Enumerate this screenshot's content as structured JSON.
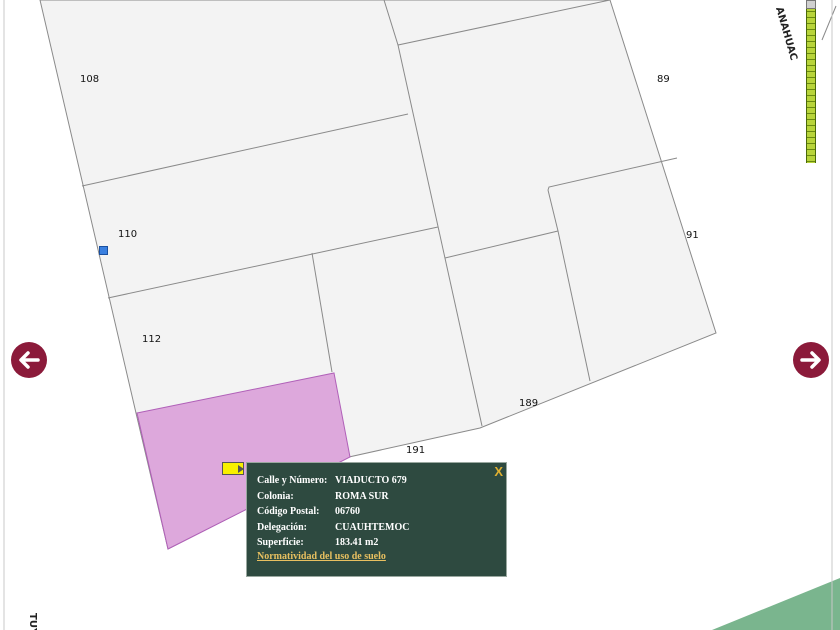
{
  "map": {
    "lot_labels": [
      "108",
      "89",
      "110",
      "91",
      "112",
      "189",
      "191"
    ],
    "street_labels": {
      "anahuac": "ANAHUAC",
      "tuxpan": "TUY"
    },
    "colors": {
      "lot_fill": "#f3f3f3",
      "lot_border": "#8a8a8a",
      "selected_fill": "#dda8dc",
      "selected_border": "#b060b8",
      "park_fill": "#7ab58e"
    }
  },
  "nav": {
    "left_icon": "arrow-left-icon",
    "right_icon": "arrow-right-icon",
    "color": "#8b1a3a"
  },
  "popup": {
    "close_label": "X",
    "rows": [
      {
        "key": "Calle y Número:",
        "value": "VIADUCTO 679"
      },
      {
        "key": "Colonia:",
        "value": "ROMA SUR"
      },
      {
        "key": "Código Postal:",
        "value": "06760"
      },
      {
        "key": "Delegación:",
        "value": "CUAUHTEMOC"
      },
      {
        "key": "Superficie:",
        "value": "183.41 m2"
      }
    ],
    "link": "Normatividad del uso de suelo",
    "colors": {
      "background": "#2e4a40",
      "text": "#ffffff",
      "link": "#e8c060",
      "close": "#e0b030"
    }
  },
  "marker": {
    "icon": "location-flag-icon"
  },
  "zoom": {
    "icon": "zoom-slider"
  }
}
